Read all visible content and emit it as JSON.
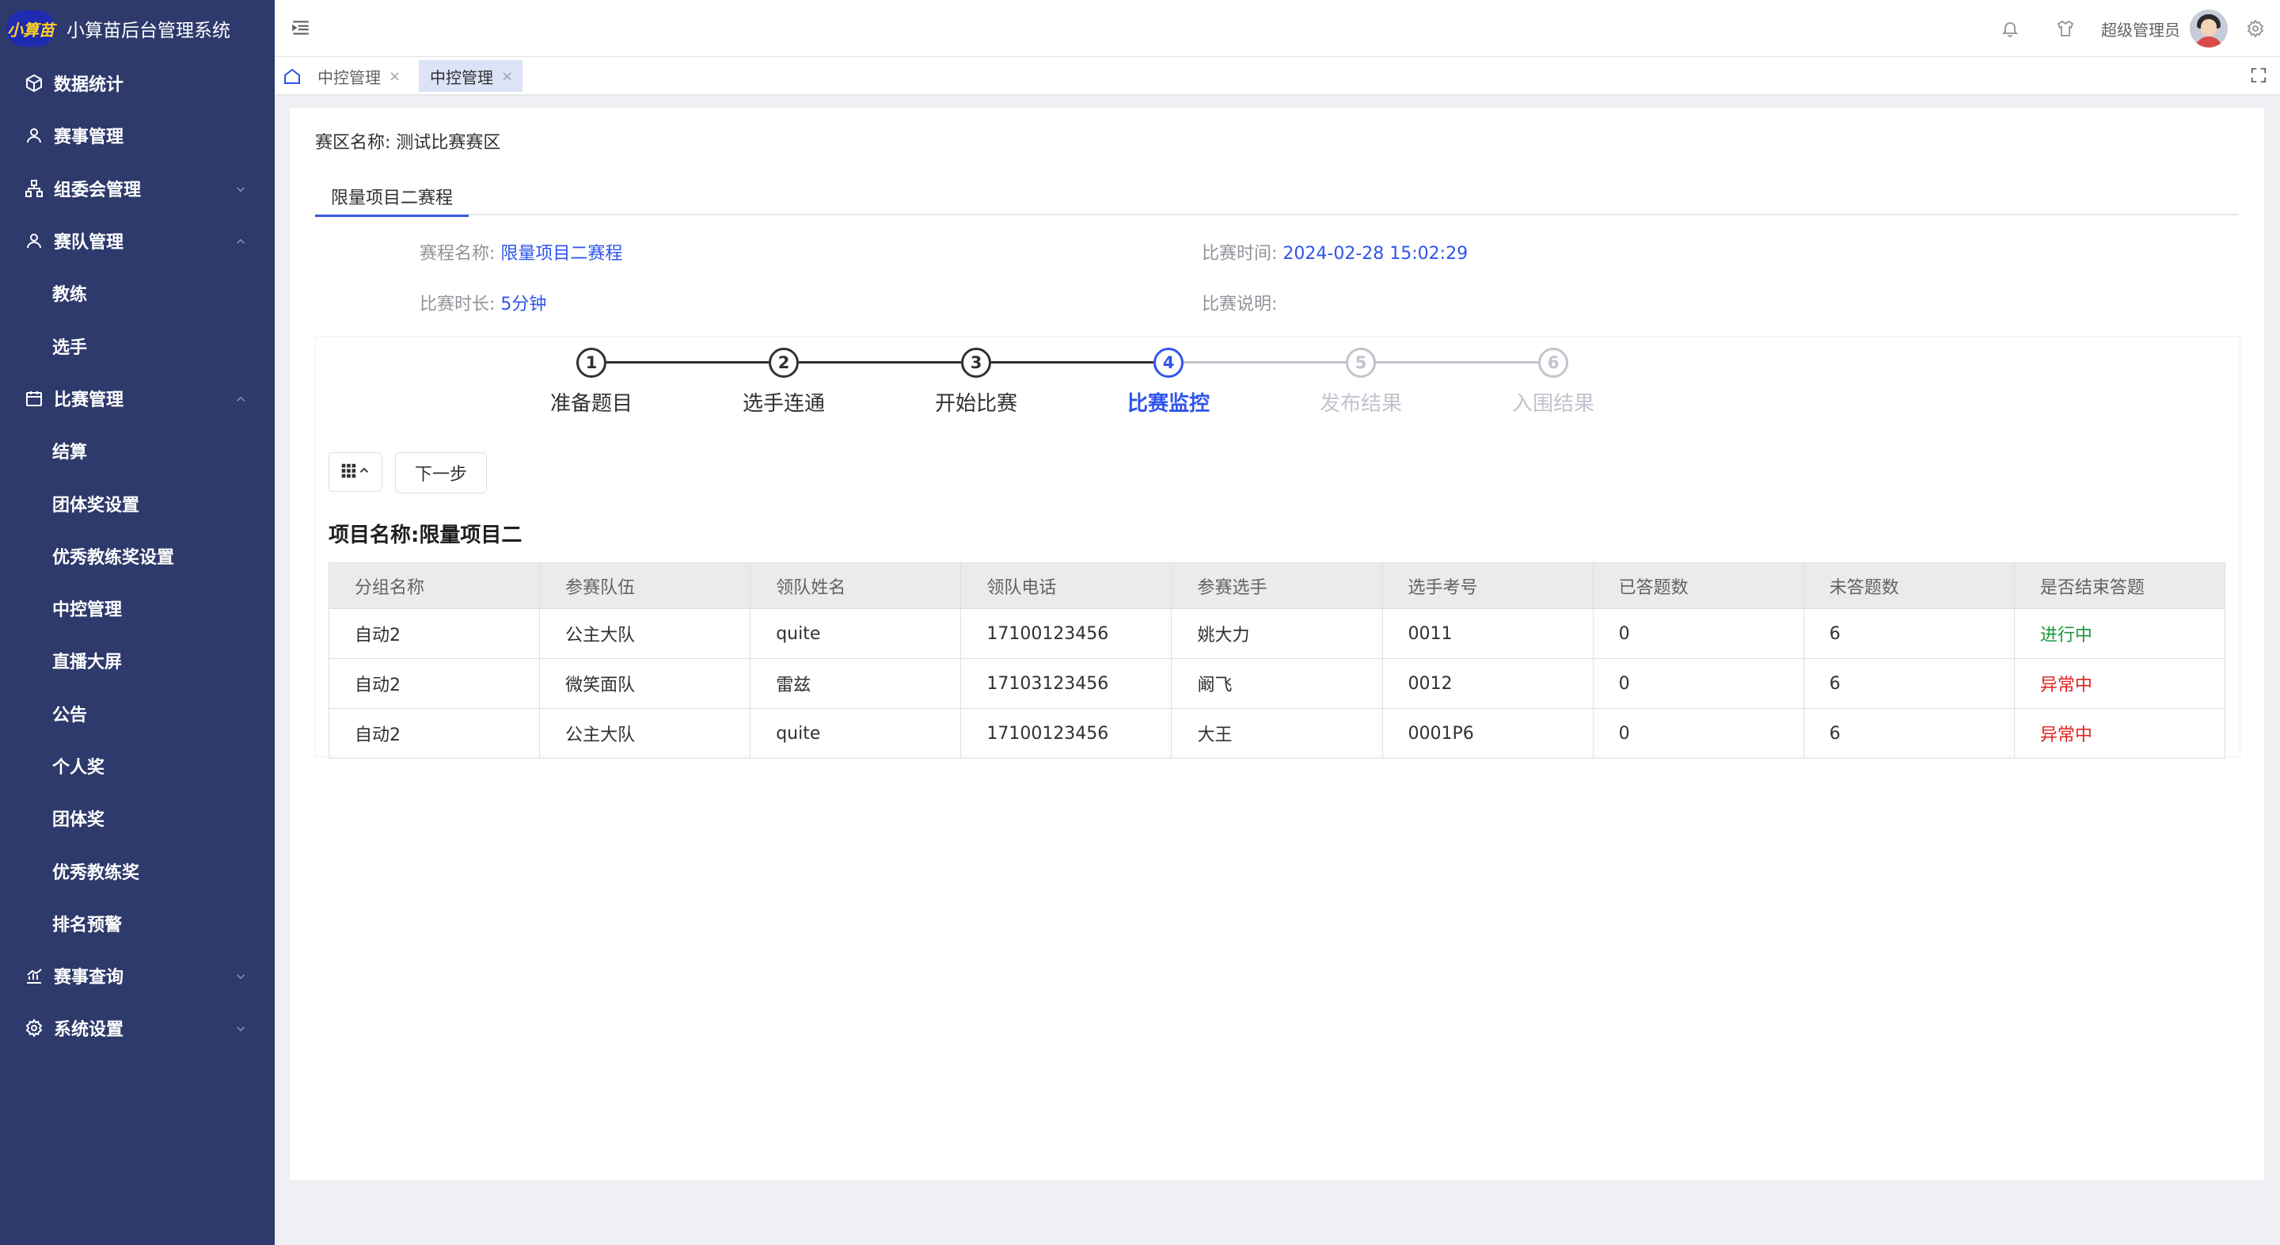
{
  "app": {
    "logo_text": "小算苗",
    "title": "小算苗后台管理系统"
  },
  "sidebar": {
    "items": [
      {
        "label": "数据统计",
        "icon": "cube-icon",
        "level": 1
      },
      {
        "label": "赛事管理",
        "icon": "user-icon",
        "level": 1
      },
      {
        "label": "组委会管理",
        "icon": "org-icon",
        "level": 1,
        "caret": "down"
      },
      {
        "label": "赛队管理",
        "icon": "user-icon",
        "level": 1,
        "caret": "up"
      },
      {
        "label": "教练",
        "level": 2
      },
      {
        "label": "选手",
        "level": 2
      },
      {
        "label": "比赛管理",
        "icon": "calendar-icon",
        "level": 1,
        "caret": "up"
      },
      {
        "label": "结算",
        "level": 2
      },
      {
        "label": "团体奖设置",
        "level": 2
      },
      {
        "label": "优秀教练奖设置",
        "level": 2
      },
      {
        "label": "中控管理",
        "level": 2
      },
      {
        "label": "直播大屏",
        "level": 2
      },
      {
        "label": "公告",
        "level": 2
      },
      {
        "label": "个人奖",
        "level": 2
      },
      {
        "label": "团体奖",
        "level": 2
      },
      {
        "label": "优秀教练奖",
        "level": 2
      },
      {
        "label": "排名预警",
        "level": 2
      },
      {
        "label": "赛事查询",
        "icon": "chart-icon",
        "level": 1,
        "caret": "down"
      },
      {
        "label": "系统设置",
        "icon": "gear-icon",
        "level": 1,
        "caret": "down"
      }
    ]
  },
  "header": {
    "user_name": "超级管理员"
  },
  "tabs": [
    {
      "label": "中控管理",
      "active": false
    },
    {
      "label": "中控管理",
      "active": true
    }
  ],
  "main": {
    "zone_label": "赛区名称:",
    "zone_value": "测试比赛赛区",
    "stage_tab": "限量项目二赛程",
    "info": {
      "schedule_label": "赛程名称:",
      "schedule_value": "限量项目二赛程",
      "time_label": "比赛时间:",
      "time_value": "2024-02-28 15:02:29",
      "duration_label": "比赛时长:",
      "duration_value": "5分钟",
      "desc_label": "比赛说明:",
      "desc_value": ""
    },
    "steps": [
      {
        "num": "1",
        "label": "准备题目",
        "state": "done"
      },
      {
        "num": "2",
        "label": "选手连通",
        "state": "done"
      },
      {
        "num": "3",
        "label": "开始比赛",
        "state": "done"
      },
      {
        "num": "4",
        "label": "比赛监控",
        "state": "active"
      },
      {
        "num": "5",
        "label": "发布结果",
        "state": "pending"
      },
      {
        "num": "6",
        "label": "入围结果",
        "state": "pending"
      }
    ],
    "next_button": "下一步",
    "project_title": "项目名称:限量项目二",
    "table": {
      "columns": [
        "分组名称",
        "参赛队伍",
        "领队姓名",
        "领队电话",
        "参赛选手",
        "选手考号",
        "已答题数",
        "未答题数",
        "是否结束答题"
      ],
      "rows": [
        [
          "自动2",
          "公主大队",
          "quite",
          "17100123456",
          "姚大力",
          "0011",
          "0",
          "6",
          "进行中"
        ],
        [
          "自动2",
          "微笑面队",
          "雷兹",
          "17103123456",
          "阚飞",
          "0012",
          "0",
          "6",
          "异常中"
        ],
        [
          "自动2",
          "公主大队",
          "quite",
          "17100123456",
          "大王",
          "0001P6",
          "0",
          "6",
          "异常中"
        ]
      ],
      "status_colors": {
        "进行中": "#1a9a3a",
        "异常中": "#e02020"
      }
    }
  }
}
